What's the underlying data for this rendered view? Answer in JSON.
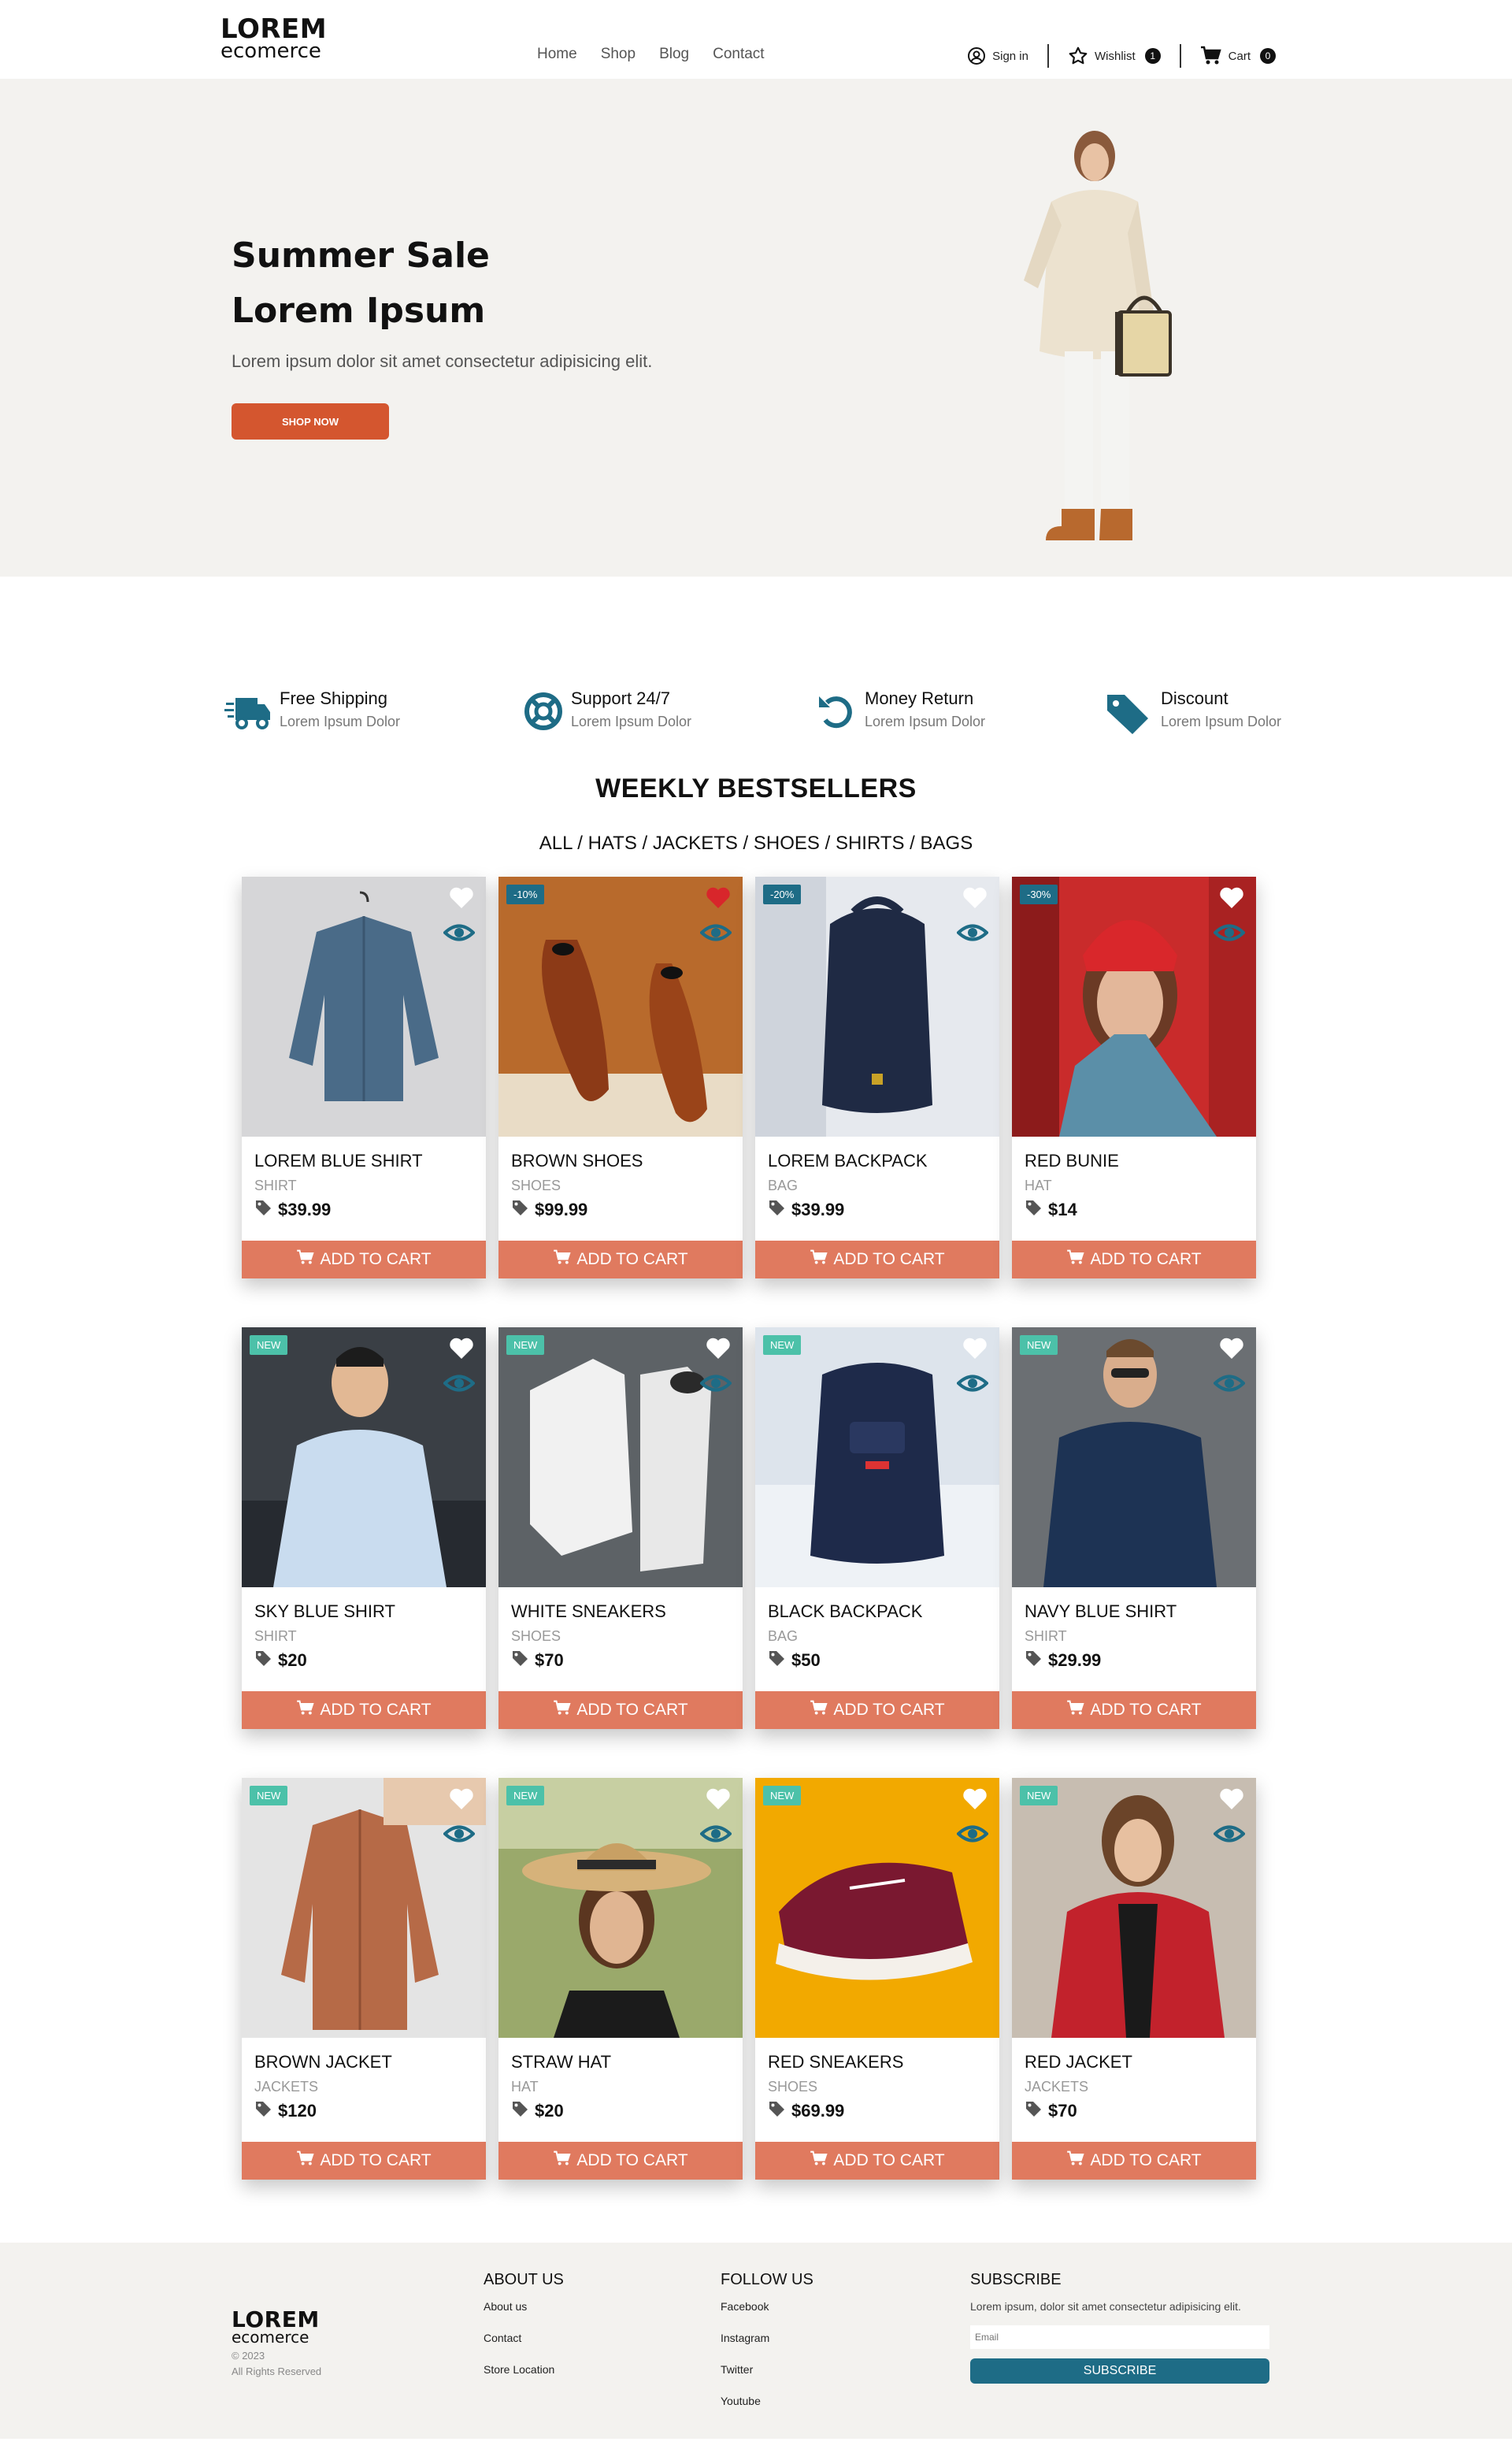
{
  "brand": {
    "title": "LOREM",
    "subtitle": "ecomerce"
  },
  "nav": [
    "Home",
    "Shop",
    "Blog",
    "Contact"
  ],
  "header_actions": {
    "signin": "Sign in",
    "wishlist": "Wishlist",
    "wishlist_count": "1",
    "cart": "Cart",
    "cart_count": "0"
  },
  "hero": {
    "title_line1": "Summer Sale",
    "title_line2": "Lorem Ipsum",
    "text": "Lorem ipsum dolor sit amet consectetur adipisicing elit.",
    "button": "SHOP NOW"
  },
  "features": [
    {
      "title": "Free Shipping",
      "sub": "Lorem Ipsum Dolor",
      "icon": "truck-icon"
    },
    {
      "title": "Support 24/7",
      "sub": "Lorem Ipsum Dolor",
      "icon": "lifebuoy-icon"
    },
    {
      "title": "Money Return",
      "sub": "Lorem Ipsum Dolor",
      "icon": "undo-icon"
    },
    {
      "title": "Discount",
      "sub": "Lorem Ipsum Dolor",
      "icon": "tag-icon"
    }
  ],
  "bestsellers": {
    "title": "WEEKLY BESTSELLERS",
    "filters": [
      "ALL",
      "HATS",
      "JACKETS",
      "SHOES",
      "SHIRTS",
      "BAGS"
    ],
    "add_label": "ADD TO CART",
    "products": [
      {
        "name": "LOREM BLUE SHIRT",
        "category": "SHIRT",
        "price": "$39.99",
        "badge": "",
        "liked": false
      },
      {
        "name": "BROWN SHOES",
        "category": "SHOES",
        "price": "$99.99",
        "badge": "-10%",
        "liked": true
      },
      {
        "name": "LOREM BACKPACK",
        "category": "BAG",
        "price": "$39.99",
        "badge": "-20%",
        "liked": false
      },
      {
        "name": "RED BUNIE",
        "category": "HAT",
        "price": "$14",
        "badge": "-30%",
        "liked": false
      },
      {
        "name": "SKY BLUE SHIRT",
        "category": "SHIRT",
        "price": "$20",
        "badge": "NEW",
        "liked": false
      },
      {
        "name": "WHITE SNEAKERS",
        "category": "SHOES",
        "price": "$70",
        "badge": "NEW",
        "liked": false
      },
      {
        "name": "BLACK BACKPACK",
        "category": "BAG",
        "price": "$50",
        "badge": "NEW",
        "liked": false
      },
      {
        "name": "NAVY BLUE SHIRT",
        "category": "SHIRT",
        "price": "$29.99",
        "badge": "NEW",
        "liked": false
      },
      {
        "name": "BROWN JACKET",
        "category": "JACKETS",
        "price": "$120",
        "badge": "NEW",
        "liked": false
      },
      {
        "name": "STRAW HAT",
        "category": "HAT",
        "price": "$20",
        "badge": "NEW",
        "liked": false
      },
      {
        "name": "RED SNEAKERS",
        "category": "SHOES",
        "price": "$69.99",
        "badge": "NEW",
        "liked": false
      },
      {
        "name": "RED JACKET",
        "category": "JACKETS",
        "price": "$70",
        "badge": "NEW",
        "liked": false
      }
    ]
  },
  "footer": {
    "copyright": "© 2023",
    "rights": "All Rights Reserved",
    "about_title": "ABOUT US",
    "about_links": [
      "About us",
      "Contact",
      "Store Location"
    ],
    "follow_title": "FOLLOW US",
    "follow_links": [
      "Facebook",
      "Instagram",
      "Twitter",
      "Youtube"
    ],
    "subscribe_title": "SUBSCRIBE",
    "subscribe_text": "Lorem ipsum, dolor sit amet consectetur adipisicing elit.",
    "email_placeholder": "Email",
    "subscribe_button": "SUBSCRIBE"
  },
  "colors": {
    "accent": "#d4562f",
    "cart_button": "#e07a5f",
    "teal": "#1e6c86",
    "new_badge": "#4cc1a9",
    "hero_bg": "#f3f2ef"
  }
}
